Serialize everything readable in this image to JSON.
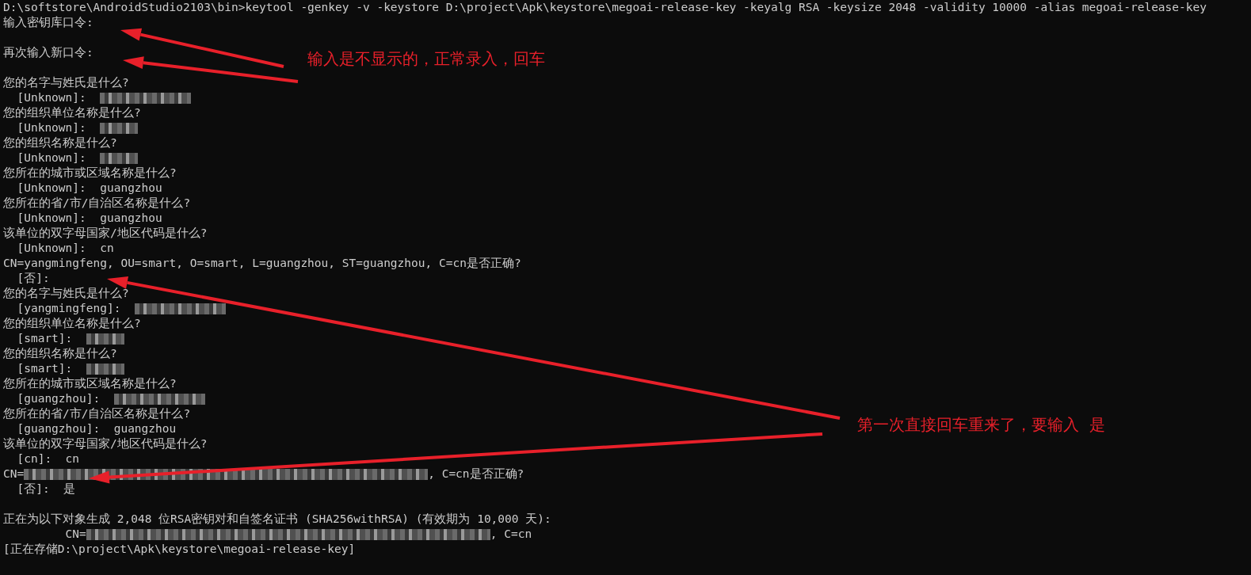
{
  "terminal": {
    "lines": [
      {
        "kind": "text",
        "parts": [
          {
            "kind": "text",
            "text": "D:\\softstore\\AndroidStudio2103\\bin>keytool -genkey -v -keystore D:\\project\\Apk\\keystore\\megoai-release-key -keyalg RSA -keysize 2048 -validity 10000 -alias megoai-release-key"
          }
        ]
      },
      {
        "kind": "text",
        "parts": [
          {
            "kind": "text",
            "text": "输入密钥库口令:"
          }
        ]
      },
      {
        "kind": "blank"
      },
      {
        "kind": "text",
        "parts": [
          {
            "kind": "text",
            "text": "再次输入新口令:"
          }
        ]
      },
      {
        "kind": "blank"
      },
      {
        "kind": "text",
        "parts": [
          {
            "kind": "text",
            "text": "您的名字与姓氏是什么?"
          }
        ]
      },
      {
        "kind": "text",
        "parts": [
          {
            "kind": "text",
            "text": "  [Unknown]:  "
          },
          {
            "kind": "redacted_medium"
          }
        ]
      },
      {
        "kind": "text",
        "parts": [
          {
            "kind": "text",
            "text": "您的组织单位名称是什么?"
          }
        ]
      },
      {
        "kind": "text",
        "parts": [
          {
            "kind": "text",
            "text": "  [Unknown]:  "
          },
          {
            "kind": "redacted_short"
          }
        ]
      },
      {
        "kind": "text",
        "parts": [
          {
            "kind": "text",
            "text": "您的组织名称是什么?"
          }
        ]
      },
      {
        "kind": "text",
        "parts": [
          {
            "kind": "text",
            "text": "  [Unknown]:  "
          },
          {
            "kind": "redacted_short"
          }
        ]
      },
      {
        "kind": "text",
        "parts": [
          {
            "kind": "text",
            "text": "您所在的城市或区域名称是什么?"
          }
        ]
      },
      {
        "kind": "text",
        "parts": [
          {
            "kind": "text",
            "text": "  [Unknown]:  guangzhou"
          }
        ]
      },
      {
        "kind": "text",
        "parts": [
          {
            "kind": "text",
            "text": "您所在的省/市/自治区名称是什么?"
          }
        ]
      },
      {
        "kind": "text",
        "parts": [
          {
            "kind": "text",
            "text": "  [Unknown]:  guangzhou"
          }
        ]
      },
      {
        "kind": "text",
        "parts": [
          {
            "kind": "text",
            "text": "该单位的双字母国家/地区代码是什么?"
          }
        ]
      },
      {
        "kind": "text",
        "parts": [
          {
            "kind": "text",
            "text": "  [Unknown]:  cn"
          }
        ]
      },
      {
        "kind": "text",
        "parts": [
          {
            "kind": "text",
            "text": "CN=yangmingfeng, OU=smart, O=smart, L=guangzhou, ST=guangzhou, C=cn是否正确?"
          }
        ]
      },
      {
        "kind": "text",
        "parts": [
          {
            "kind": "text",
            "text": "  [否]:"
          }
        ]
      },
      {
        "kind": "text",
        "parts": [
          {
            "kind": "text",
            "text": "您的名字与姓氏是什么?"
          }
        ]
      },
      {
        "kind": "text",
        "parts": [
          {
            "kind": "text",
            "text": "  [yangmingfeng]:  "
          },
          {
            "kind": "redacted_medium"
          }
        ]
      },
      {
        "kind": "text",
        "parts": [
          {
            "kind": "text",
            "text": "您的组织单位名称是什么?"
          }
        ]
      },
      {
        "kind": "text",
        "parts": [
          {
            "kind": "text",
            "text": "  [smart]:  "
          },
          {
            "kind": "redacted_short"
          }
        ]
      },
      {
        "kind": "text",
        "parts": [
          {
            "kind": "text",
            "text": "您的组织名称是什么?"
          }
        ]
      },
      {
        "kind": "text",
        "parts": [
          {
            "kind": "text",
            "text": "  [smart]:  "
          },
          {
            "kind": "redacted_short"
          }
        ]
      },
      {
        "kind": "text",
        "parts": [
          {
            "kind": "text",
            "text": "您所在的城市或区域名称是什么?"
          }
        ]
      },
      {
        "kind": "text",
        "parts": [
          {
            "kind": "text",
            "text": "  [guangzhou]:  "
          },
          {
            "kind": "redacted_medium"
          }
        ]
      },
      {
        "kind": "text",
        "parts": [
          {
            "kind": "text",
            "text": "您所在的省/市/自治区名称是什么?"
          }
        ]
      },
      {
        "kind": "text",
        "parts": [
          {
            "kind": "text",
            "text": "  [guangzhou]:  guangzhou"
          }
        ]
      },
      {
        "kind": "text",
        "parts": [
          {
            "kind": "text",
            "text": "该单位的双字母国家/地区代码是什么?"
          }
        ]
      },
      {
        "kind": "text",
        "parts": [
          {
            "kind": "text",
            "text": "  [cn]:  cn"
          }
        ]
      },
      {
        "kind": "text",
        "parts": [
          {
            "kind": "text",
            "text": "CN="
          },
          {
            "kind": "redacted_long"
          },
          {
            "kind": "text",
            "text": ", C=cn是否正确?"
          }
        ]
      },
      {
        "kind": "text",
        "parts": [
          {
            "kind": "text",
            "text": "  [否]:  是"
          }
        ]
      },
      {
        "kind": "blank"
      },
      {
        "kind": "text",
        "parts": [
          {
            "kind": "text",
            "text": "正在为以下对象生成 2,048 位RSA密钥对和自签名证书 (SHA256withRSA) (有效期为 10,000 天):"
          }
        ]
      },
      {
        "kind": "text",
        "parts": [
          {
            "kind": "text",
            "text": "         CN="
          },
          {
            "kind": "redacted_long"
          },
          {
            "kind": "text",
            "text": ", C=cn"
          }
        ]
      },
      {
        "kind": "text",
        "parts": [
          {
            "kind": "text",
            "text": "[正在存储D:\\project\\Apk\\keystore\\megoai-release-key]"
          }
        ]
      }
    ]
  },
  "annotations": [
    {
      "text": "输入是不显示的，正常录入，回车"
    },
    {
      "text": "第一次直接回车重来了，要输入  是"
    }
  ]
}
